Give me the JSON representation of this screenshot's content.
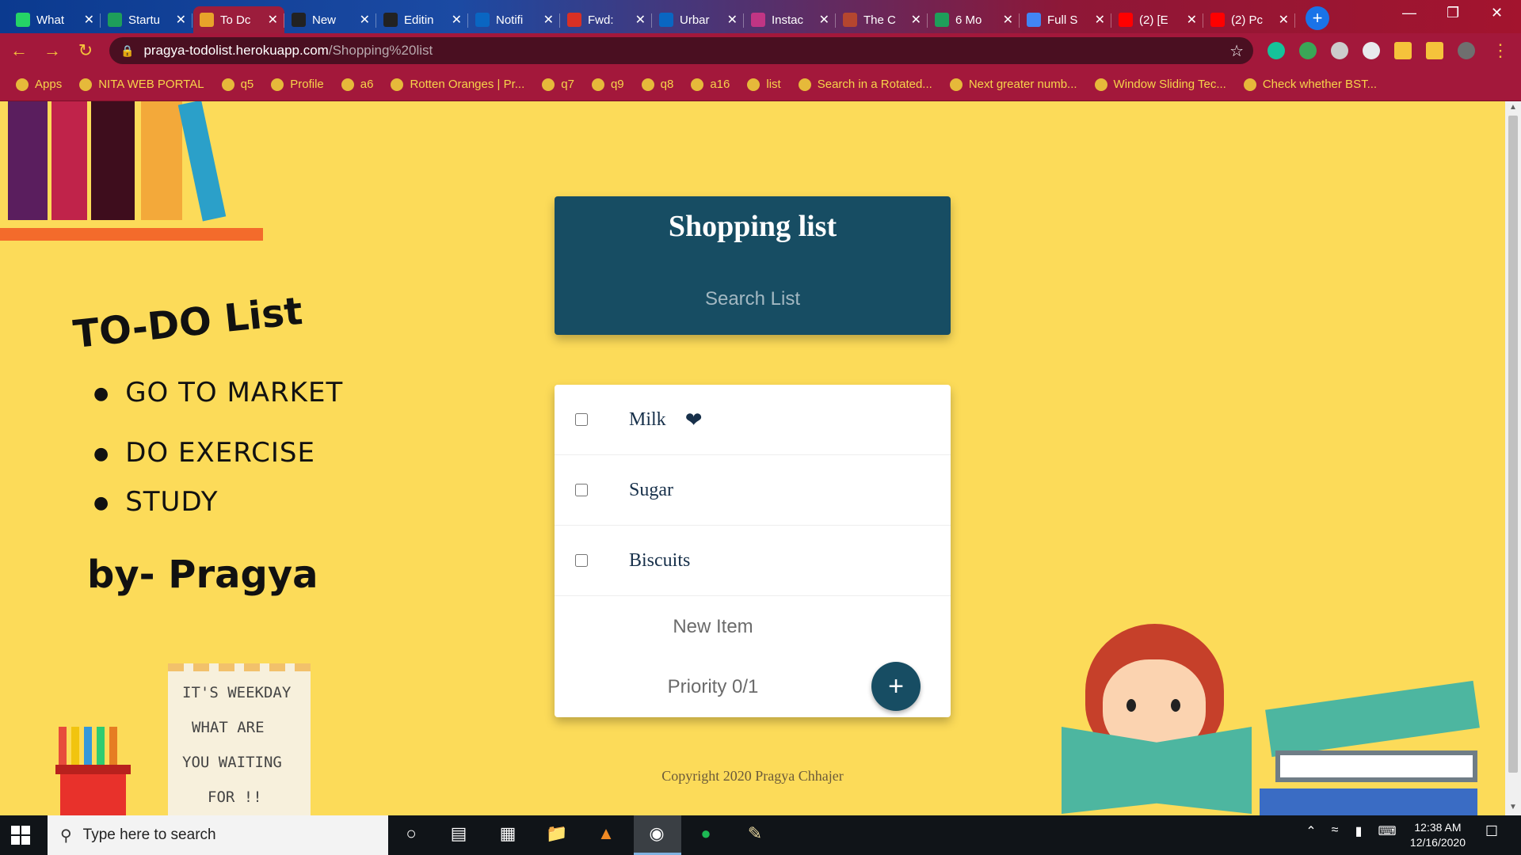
{
  "browser": {
    "tabs": [
      {
        "label": "What",
        "icon": "whatsapp-icon",
        "color": "#25d366",
        "active": false
      },
      {
        "label": "Startu",
        "icon": "plus-icon",
        "color": "#1e9e5a",
        "active": false
      },
      {
        "label": "To Dc",
        "icon": "chrome-icon",
        "color": "#e8a32a",
        "active": true
      },
      {
        "label": "New",
        "icon": "github-icon",
        "color": "#222222",
        "active": false
      },
      {
        "label": "Editin",
        "icon": "github-icon",
        "color": "#222222",
        "active": false
      },
      {
        "label": "Notifi",
        "icon": "linkedin-icon",
        "color": "#0a66c2",
        "active": false
      },
      {
        "label": "Fwd:",
        "icon": "gmail-icon",
        "color": "#d93025",
        "active": false
      },
      {
        "label": "Urbar",
        "icon": "linkedin-icon",
        "color": "#0a66c2",
        "active": false
      },
      {
        "label": "Instac",
        "icon": "instagram-icon",
        "color": "#c13584",
        "active": false
      },
      {
        "label": "The C",
        "icon": "codechef-icon",
        "color": "#b5462f",
        "active": false
      },
      {
        "label": "6 Mo",
        "icon": "plus-icon",
        "color": "#1e9e5a",
        "active": false
      },
      {
        "label": "Full S",
        "icon": "docs-icon",
        "color": "#4285f4",
        "active": false
      },
      {
        "label": "(2) [E",
        "icon": "youtube-icon",
        "color": "#ff0000",
        "active": false
      },
      {
        "label": "(2) Pc",
        "icon": "youtube-icon",
        "color": "#ff0000",
        "active": false
      }
    ],
    "url_host": "pragya-todolist.herokuapp.com",
    "url_path": "/Shopping%20list",
    "bookmarks": [
      "Apps",
      "NITA WEB PORTAL",
      "q5",
      "Profile",
      "a6",
      "Rotten Oranges | Pr...",
      "q7",
      "q9",
      "q8",
      "a16",
      "list",
      "Search in a Rotated...",
      "Next greater numb...",
      "Window Sliding Tec...",
      "Check whether BST..."
    ]
  },
  "app": {
    "list_title": "Shopping list",
    "search_placeholder": "Search List",
    "items": [
      {
        "name": "Milk",
        "checked": false,
        "favorite": true
      },
      {
        "name": "Sugar",
        "checked": false,
        "favorite": false
      },
      {
        "name": "Biscuits",
        "checked": false,
        "favorite": false
      }
    ],
    "new_item_placeholder": "New Item",
    "priority_placeholder": "Priority 0/1",
    "add_label": "+",
    "copyright": "Copyright 2020 Pragya Chhajer",
    "theme": {
      "background": "#fcdb59",
      "primary": "#174d63"
    }
  },
  "decoration": {
    "title": "TO-DO List",
    "bullets": [
      "GO TO MARKET",
      "DO EXERCISE",
      "STUDY"
    ],
    "author": "by- Pragya",
    "note_lines": [
      "IT'S WEEKDAY",
      "WHAT ARE",
      "YOU WAITING",
      "FOR !!"
    ]
  },
  "taskbar": {
    "search_placeholder": "Type here to search",
    "time": "12:38 AM",
    "date": "12/16/2020"
  }
}
